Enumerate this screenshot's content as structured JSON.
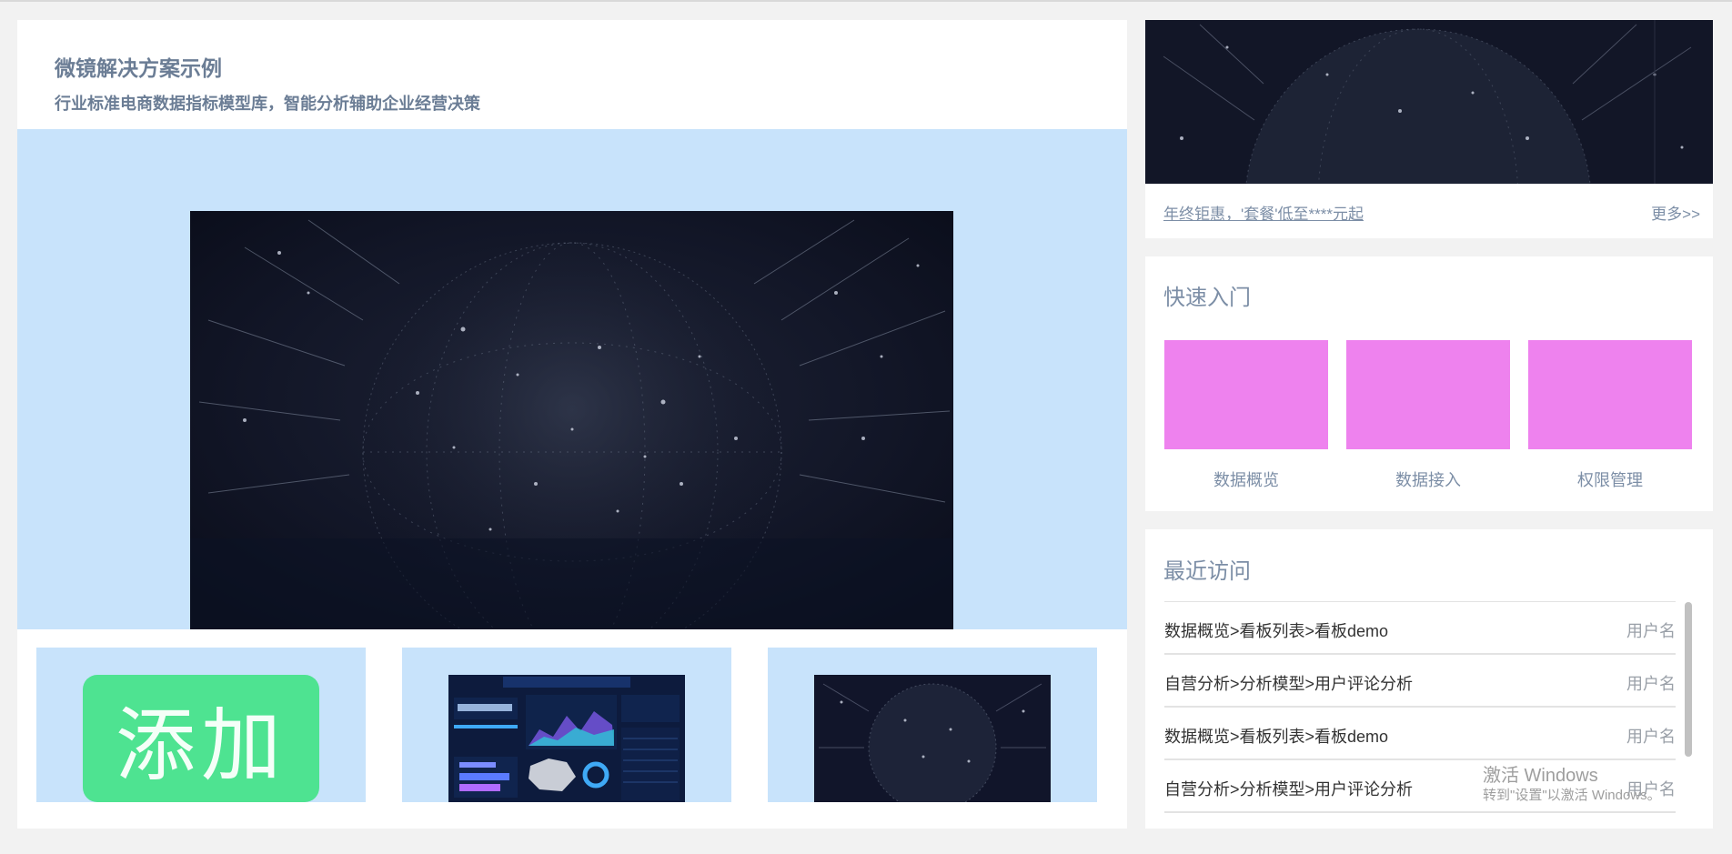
{
  "colors": {
    "page_bg": "#f2f2f2",
    "card_bg": "#ffffff",
    "hero_bg": "#c8e3fb",
    "title_text": "#6b7d95",
    "accent_green": "#4ee391",
    "tile_violet": "#ee82ee",
    "space_dark": "#0f1324"
  },
  "main": {
    "title": "微镜解决方案示例",
    "subtitle": "行业标准电商数据指标模型库，智能分析辅助企业经营决策",
    "hero_image": "globe-network-image",
    "thumbnails": [
      {
        "kind": "add-button",
        "label": "添加"
      },
      {
        "kind": "dashboard-preview",
        "image": "big-screen-dashboard-image"
      },
      {
        "kind": "globe-preview",
        "image": "globe-network-image"
      }
    ]
  },
  "banner": {
    "image": "globe-network-image",
    "promo_text": "年终钜惠，'套餐'低至****元起",
    "more_text": "更多>>"
  },
  "quick_start": {
    "title": "快速入门",
    "items": [
      {
        "label": "数据概览"
      },
      {
        "label": "数据接入"
      },
      {
        "label": "权限管理"
      }
    ]
  },
  "recent": {
    "title": "最近访问",
    "rows": [
      {
        "path": "数据概览>看板列表>看板demo",
        "user": "用户名"
      },
      {
        "path": "自营分析>分析模型>用户评论分析",
        "user": "用户名"
      },
      {
        "path": "数据概览>看板列表>看板demo",
        "user": "用户名"
      },
      {
        "path": "自营分析>分析模型>用户评论分析",
        "user": "用户名"
      }
    ]
  },
  "watermark": {
    "line1": "激活 Windows",
    "line2": "转到\"设置\"以激活 Windows。"
  }
}
